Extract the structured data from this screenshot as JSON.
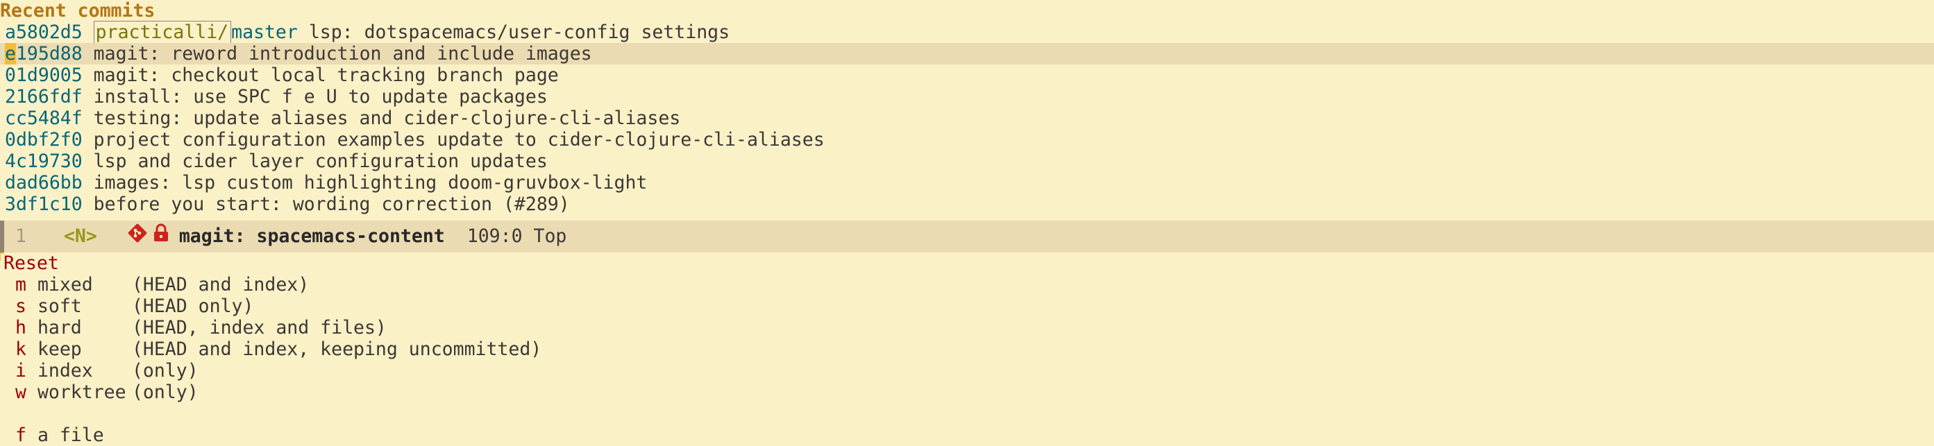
{
  "commits": {
    "heading": "Recent commits",
    "top": {
      "hash": "a5802d5",
      "remote": "practicalli/",
      "branch": "master",
      "message": "lsp: dotspacemacs/user-config settings"
    },
    "items": [
      {
        "hash_first": "e",
        "hash_rest": "195d88",
        "message": "magit: reword introduction and include images"
      },
      {
        "hash": "01d9005",
        "message": "magit: checkout local tracking branch page"
      },
      {
        "hash": "2166fdf",
        "message": "install: use SPC f e U to update packages"
      },
      {
        "hash": "cc5484f",
        "message": "testing: update aliases and cider-clojure-cli-aliases"
      },
      {
        "hash": "0dbf2f0",
        "message": "project configuration examples update to cider-clojure-cli-aliases"
      },
      {
        "hash": "4c19730",
        "message": "lsp and cider layer configuration updates"
      },
      {
        "hash": "dad66bb",
        "message": "images: lsp custom highlighting doom-gruvbox-light"
      },
      {
        "hash": "3df1c10",
        "message": "before you start: wording correction (#289)"
      }
    ]
  },
  "modeline": {
    "window_number": "1",
    "state": "<N>",
    "buffer": "magit: spacemacs-content",
    "position": "109:0",
    "scroll": "Top",
    "git_icon": "git-icon",
    "lock_icon": "lock-icon",
    "git_color": "#cc241d",
    "lock_color": "#cc241d"
  },
  "reset": {
    "title": "Reset",
    "options": [
      {
        "key": "m",
        "label": "mixed",
        "desc": "(HEAD and index)"
      },
      {
        "key": "s",
        "label": "soft",
        "desc": "(HEAD only)"
      },
      {
        "key": "h",
        "label": "hard",
        "desc": "(HEAD, index and files)"
      },
      {
        "key": "k",
        "label": "keep",
        "desc": "(HEAD and index, keeping uncommitted)"
      },
      {
        "key": "i",
        "label": "index",
        "desc": "(only)"
      },
      {
        "key": "w",
        "label": "worktree",
        "desc": "(only)"
      }
    ],
    "file_option": {
      "key": "f",
      "label": "a file"
    }
  }
}
